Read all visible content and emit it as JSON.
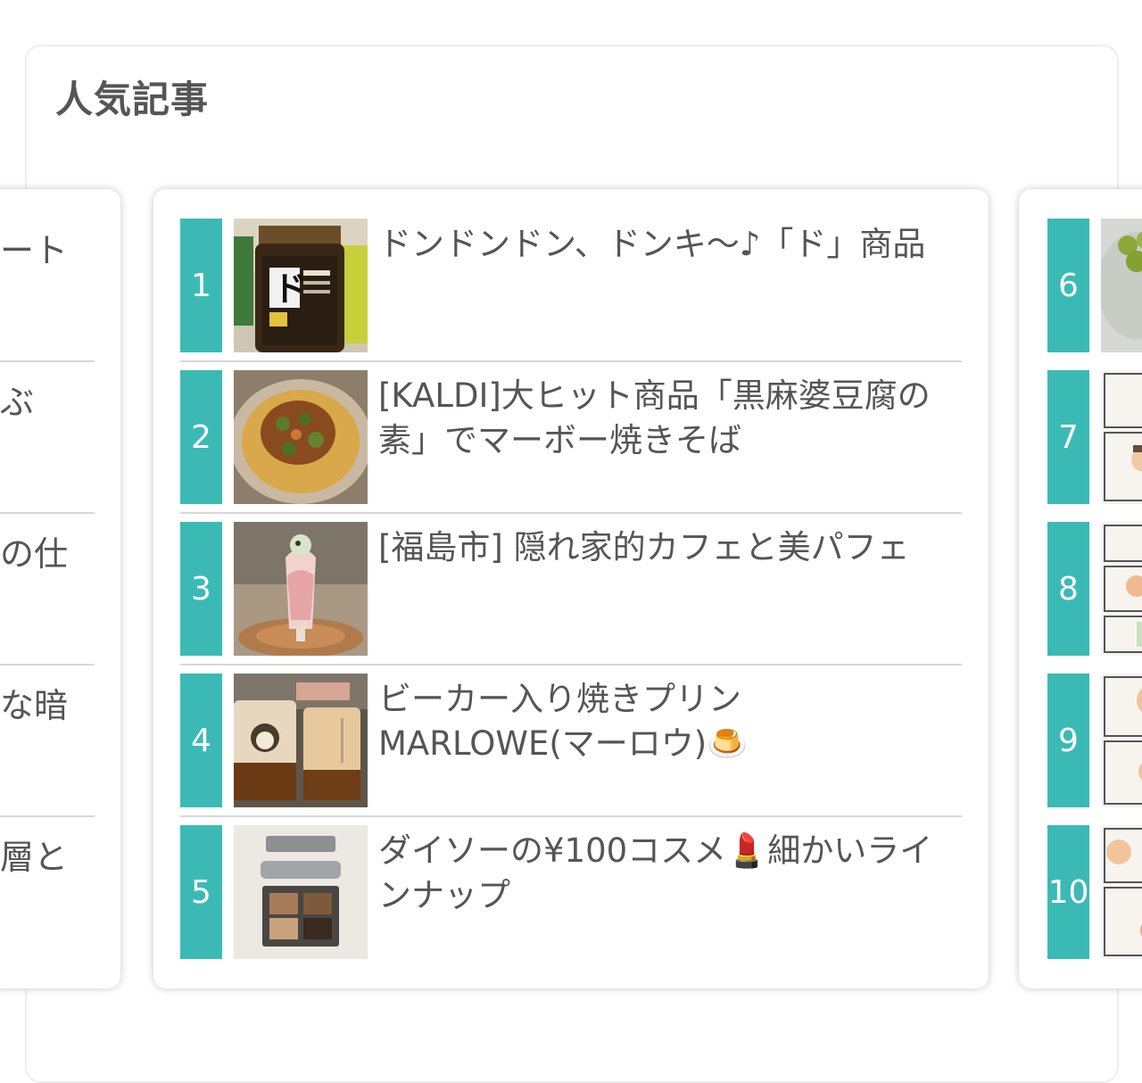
{
  "section": {
    "title": "人気記事"
  },
  "left_card": {
    "snippets": [
      "ート",
      "ぶ",
      "の仕",
      "な暗",
      "層と"
    ]
  },
  "center_card": {
    "items": [
      {
        "rank": "1",
        "title": "ドンドンドン、ドンキ〜♪「ド」商品",
        "thumb": "jar"
      },
      {
        "rank": "2",
        "title": "[KALDI]大ヒット商品「黒麻婆豆腐の素」でマーボー焼きそば",
        "thumb": "noodles"
      },
      {
        "rank": "3",
        "title": "[福島市] 隠れ家的カフェと美パフェ",
        "thumb": "parfait"
      },
      {
        "rank": "4",
        "title": "ビーカー入り焼きプリン MARLOWE(マーロウ)🍮",
        "thumb": "pudding"
      },
      {
        "rank": "5",
        "title": "ダイソーの¥100コスメ💄細かいラインナップ",
        "thumb": "cosmetics"
      }
    ]
  },
  "right_card": {
    "items": [
      {
        "rank": "6",
        "thumb": "grapes"
      },
      {
        "rank": "7",
        "thumb": "comic"
      },
      {
        "rank": "8",
        "thumb": "comic"
      },
      {
        "rank": "9",
        "thumb": "comic"
      },
      {
        "rank": "10",
        "thumb": "comic"
      }
    ]
  }
}
